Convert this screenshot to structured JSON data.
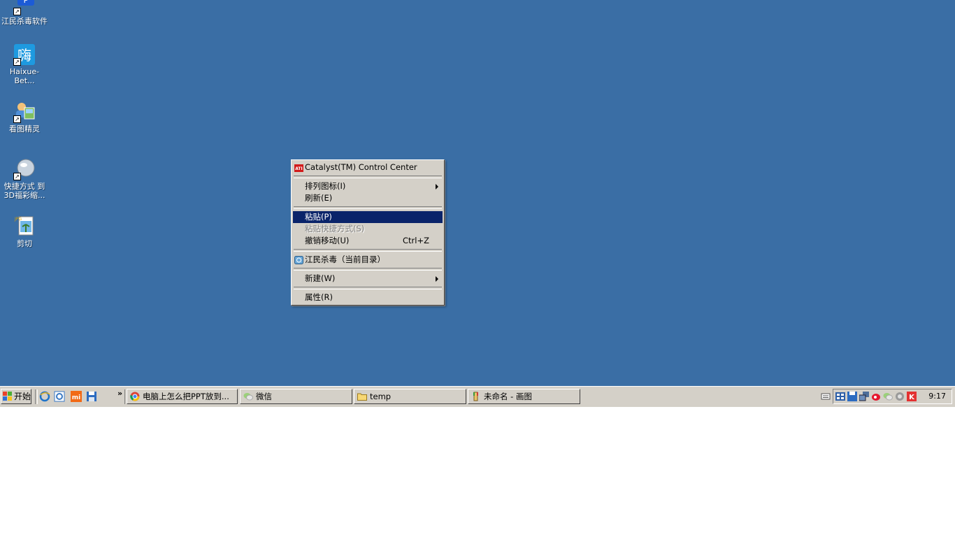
{
  "desktop": {
    "icons": [
      {
        "label": "江民杀毒软件",
        "icon": "jiangmin-antivirus-icon"
      },
      {
        "label": "Haixue-Bet...",
        "icon": "haixue-icon",
        "glyph": "嗨"
      },
      {
        "label": "看图精灵",
        "icon": "image-viewer-icon"
      },
      {
        "label": "快捷方式 到 3D福彩缩...",
        "icon": "shortcut-3d-lottery-icon"
      },
      {
        "label": "剪切",
        "icon": "jpg-file-icon",
        "badge": "JPG"
      }
    ]
  },
  "context_menu": {
    "items": [
      {
        "label": "Catalyst(TM) Control Center",
        "icon": "ati-icon",
        "icon_text": "ATI"
      },
      {
        "label": "排列图标(I)",
        "submenu": true
      },
      {
        "label": "刷新(E)"
      },
      {
        "label": "粘贴(P)",
        "highlighted": true
      },
      {
        "label": "粘贴快捷方式(S)",
        "disabled": true
      },
      {
        "label": "撤销移动(U)",
        "shortcut": "Ctrl+Z"
      },
      {
        "label": "江民杀毒（当前目录）",
        "icon": "jiangmin-scan-icon"
      },
      {
        "label": "新建(W)",
        "submenu": true
      },
      {
        "label": "属性(R)"
      }
    ]
  },
  "taskbar": {
    "start_label": "开始",
    "quick_launch": [
      "ie-icon",
      "ie-alt-icon",
      "xiaomi-icon",
      "save-disk-icon"
    ],
    "more_glyph": "»",
    "buttons": [
      {
        "label": "电脑上怎么把PPT放到...",
        "icon": "chrome-icon"
      },
      {
        "label": "微信",
        "icon": "wechat-icon"
      },
      {
        "label": "temp",
        "icon": "folder-icon"
      },
      {
        "label": "未命名 - 画图",
        "icon": "paint-icon"
      }
    ],
    "clock": "9:17"
  },
  "colors": {
    "desktop": "#3a6ea5",
    "taskbar": "#d4d0c8",
    "highlight": "#0a246a"
  }
}
